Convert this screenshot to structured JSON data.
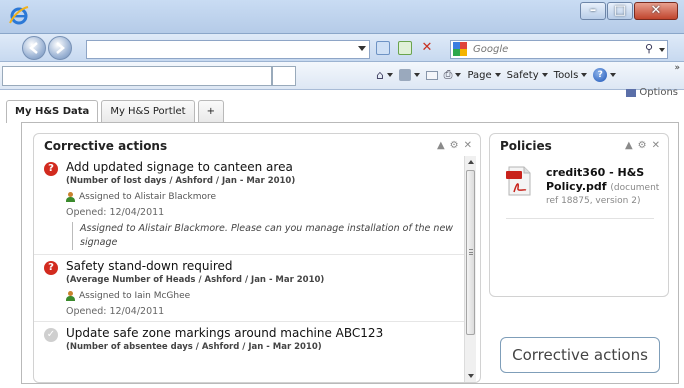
{
  "browser": {
    "search": {
      "placeholder": "Google"
    },
    "command_bar": {
      "page_label": "Page",
      "safety_label": "Safety",
      "tools_label": "Tools",
      "more_chevron": "»"
    }
  },
  "page": {
    "options_label": "Options",
    "tabs": [
      {
        "label": "My H&S Data",
        "active": true
      },
      {
        "label": "My H&S Portlet",
        "active": false
      },
      {
        "label": "+",
        "active": false
      }
    ],
    "corrective_actions": {
      "title": "Corrective actions",
      "controls": {
        "collapse": "▲",
        "settings": "⚙",
        "close": "✕"
      },
      "items": [
        {
          "status": "open",
          "status_glyph": "?",
          "title": "Add updated signage to canteen area",
          "subtitle": "(Number of lost days / Ashford / Jan - Mar 2010)",
          "assigned": "Assigned to Alistair Blackmore",
          "opened": "Opened: 12/04/2011",
          "note": "Assigned to Alistair Blackmore. Please can you manage installation of the new signage"
        },
        {
          "status": "open",
          "status_glyph": "?",
          "title": "Safety stand-down required",
          "subtitle": "(Average Number of Heads / Ashford / Jan - Mar 2010)",
          "assigned": "Assigned to Iain McGhee",
          "opened": "Opened: 12/04/2011"
        },
        {
          "status": "done",
          "status_glyph": "✓",
          "title": "Update safe zone markings around machine ABC123",
          "subtitle": "(Number of absentee days / Ashford / Jan - Mar 2010)"
        }
      ]
    },
    "policies": {
      "title": "Policies",
      "controls": {
        "collapse": "▲",
        "settings": "⚙",
        "close": "✕"
      },
      "items": [
        {
          "name": "credit360 - H&S Policy.pdf",
          "meta_inline": "(document",
          "meta_rest": "ref 18875, version 2)"
        }
      ]
    },
    "ca_button_label": "Corrective actions"
  },
  "colors": {
    "status_open": "#d22b1f",
    "status_done": "#cfcfcf",
    "button_border": "#7f9eb9"
  }
}
